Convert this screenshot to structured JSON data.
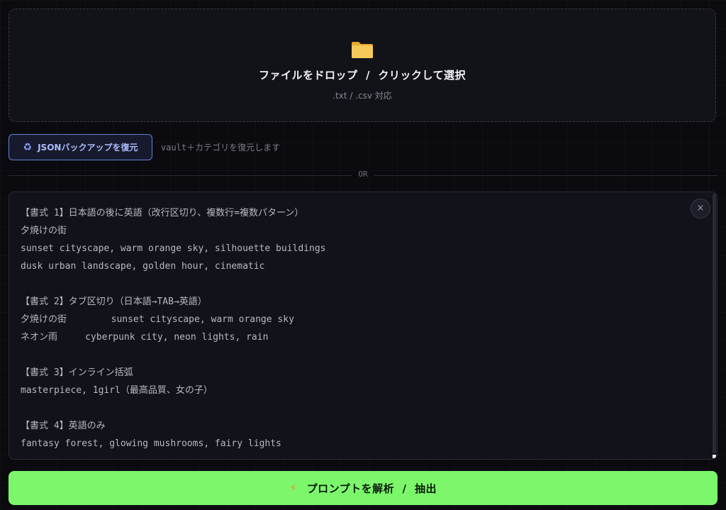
{
  "dropzone": {
    "icon": "folder-icon",
    "title": "ファイルをドロップ  /  クリックして選択",
    "subtitle": ".txt / .csv 対応"
  },
  "restore": {
    "icon": "recycle-icon",
    "button_label": "JSONバックアップを復元",
    "hint": "vault＋カテゴリを復元します"
  },
  "divider": {
    "label": "OR"
  },
  "editor": {
    "clear_icon": "close-icon",
    "clear_label": "×",
    "lines": [
      "【書式 1】日本語の後に英語（改行区切り、複数行=複数パターン）",
      "夕焼けの街",
      "sunset cityscape, warm orange sky, silhouette buildings",
      "dusk urban landscape, golden hour, cinematic",
      "",
      "【書式 2】タブ区切り（日本語→TAB→英語）",
      "夕焼けの街        sunset cityscape, warm orange sky",
      "ネオン雨     cyberpunk city, neon lights, rain",
      "",
      "【書式 3】インライン括弧",
      "masterpiece, 1girl（最高品質、女の子）",
      "",
      "【書式 4】英語のみ",
      "fantasy forest, glowing mushrooms, fairy lights"
    ]
  },
  "analyze": {
    "icon": "bolt-icon",
    "label": "プロンプトを解析  /  抽出"
  },
  "colors": {
    "background": "#0b0b0f",
    "accent_green": "#7cf76c",
    "restore_border": "#6a7fd6",
    "folder_yellow": "#f5c451"
  }
}
